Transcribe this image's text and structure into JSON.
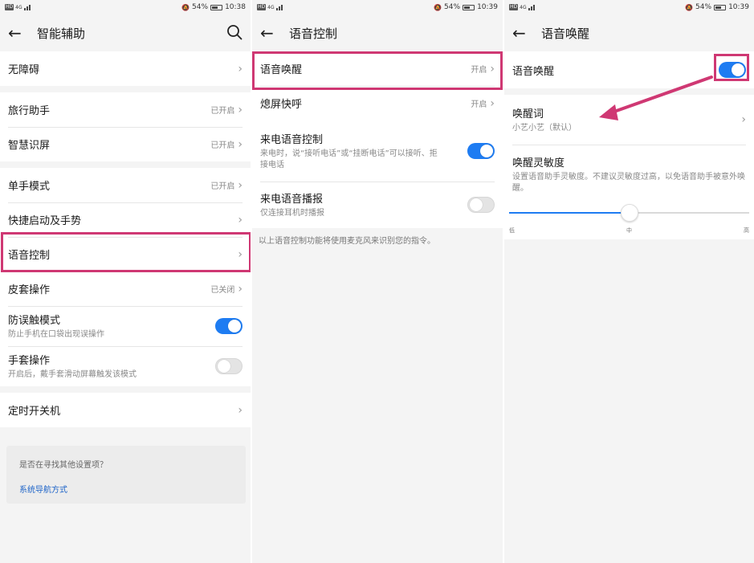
{
  "status_bars": [
    {
      "hd": "HD",
      "net": "4G",
      "battery": "54%",
      "time": "10:38"
    },
    {
      "hd": "HD",
      "net": "4G",
      "battery": "54%",
      "time": "10:39"
    },
    {
      "hd": "HD",
      "net": "4G",
      "battery": "54%",
      "time": "10:39"
    }
  ],
  "icons": {
    "back": "back-arrow-icon",
    "search": "search-icon",
    "chevron": "chevron-right-icon",
    "battery": "battery-icon",
    "mute": "mute-icon",
    "signal": "signal-icon"
  },
  "colors": {
    "accent": "#1e7cf2",
    "highlight": "#cf3873",
    "link": "#1e64c8"
  },
  "glyphs": {
    "back": "←",
    "chevron": "›",
    "mute": "🔕"
  },
  "panel1": {
    "title": "智能辅助",
    "groups": [
      [
        {
          "label": "无障碍"
        }
      ],
      [
        {
          "label": "旅行助手",
          "status": "已开启"
        },
        {
          "label": "智慧识屏",
          "status": "已开启"
        }
      ],
      [
        {
          "label": "单手模式",
          "status": "已开启"
        },
        {
          "label": "快捷启动及手势"
        },
        {
          "label": "语音控制",
          "highlighted": true
        },
        {
          "label": "皮套操作",
          "status": "已关闭"
        },
        {
          "label": "防误触模式",
          "sub": "防止手机在口袋出现误操作",
          "toggle": true
        },
        {
          "label": "手套操作",
          "sub": "开启后，戴手套滑动屏幕触发该模式",
          "toggle": false
        }
      ],
      [
        {
          "label": "定时开关机"
        }
      ]
    ],
    "suggest": {
      "question": "是否在寻找其他设置项？",
      "link": "系统导航方式"
    }
  },
  "panel2": {
    "title": "语音控制",
    "rows": [
      {
        "label": "语音唤醒",
        "status": "开启",
        "highlighted": true
      },
      {
        "label": "熄屏快呼",
        "status": "开启"
      },
      {
        "label": "来电语音控制",
        "sub": "来电时，说“接听电话”或“挂断电话”可以接听、拒接电话",
        "toggle": true
      },
      {
        "label": "来电语音播报",
        "sub": "仅连接耳机时播报",
        "toggle": false
      }
    ],
    "note": "以上语音控制功能将使用麦克风来识别您的指令。"
  },
  "panel3": {
    "title": "语音唤醒",
    "toggle_row": {
      "label": "语音唤醒",
      "toggle": true
    },
    "wake_word": {
      "label": "唤醒词",
      "value": "小艺小艺（默认）"
    },
    "sensitivity": {
      "label": "唤醒灵敏度",
      "desc": "设置语音助手灵敏度。不建议灵敏度过高，以免语音助手被意外唤醒。",
      "level": 0.5,
      "ticks": [
        "低",
        "中",
        "高"
      ]
    }
  }
}
